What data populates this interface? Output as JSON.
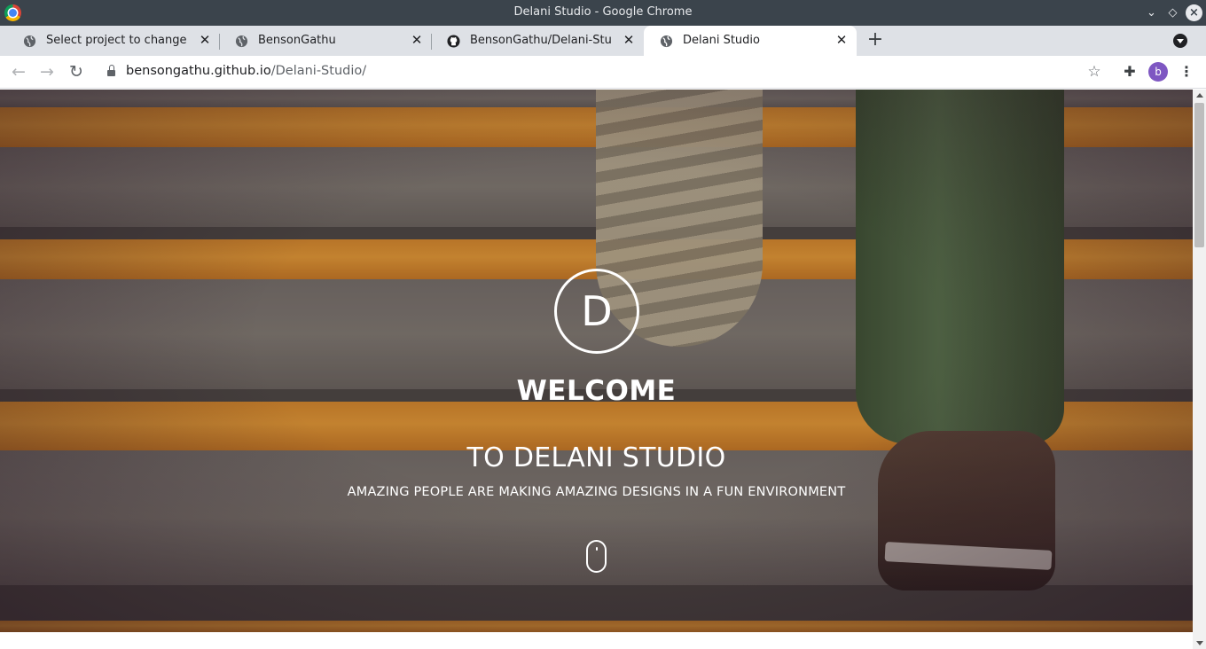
{
  "window": {
    "title": "Delani Studio - Google Chrome"
  },
  "tabs": [
    {
      "label": "Select project to change | Dja",
      "favicon": "globe-icon",
      "active": false
    },
    {
      "label": "BensonGathu",
      "favicon": "globe-icon",
      "active": false
    },
    {
      "label": "BensonGathu/Delani-Studio: I",
      "favicon": "github-icon",
      "active": false
    },
    {
      "label": "Delani Studio",
      "favicon": "globe-icon",
      "active": true
    }
  ],
  "toolbar": {
    "url_host": "bensongathu.github.io",
    "url_path": "/Delani-Studio/",
    "profile_initial": "b",
    "profile_color": "#7e57c2"
  },
  "hero": {
    "logo_letter": "D",
    "welcome": "WELCOME",
    "subtitle": "TO DELANI STUDIO",
    "tagline": "AMAZING PEOPLE ARE MAKING AMAZING DESIGNS IN A FUN ENVIRONMENT"
  },
  "colors": {
    "titlebar": "#3b444c",
    "tabstrip": "#dee1e6",
    "accent_orange": "#e59a33"
  }
}
